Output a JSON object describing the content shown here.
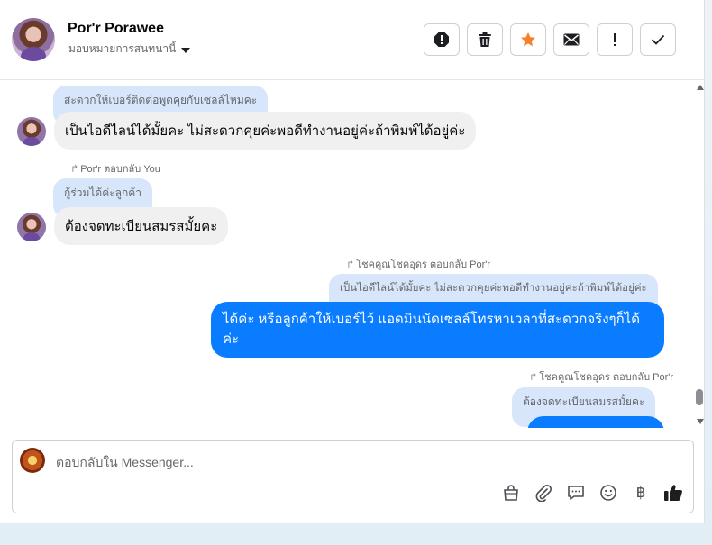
{
  "header": {
    "contact_name": "Por'r Porawee",
    "assign_label": "มอบหมายการสนทนานี้",
    "toolbar_buttons": [
      {
        "icon": "alert-circle-icon"
      },
      {
        "icon": "trash-icon"
      },
      {
        "icon": "star-icon",
        "color": "#f5822a"
      },
      {
        "icon": "envelope-icon"
      },
      {
        "icon": "exclamation-icon"
      },
      {
        "icon": "check-icon"
      }
    ]
  },
  "messages": {
    "m1": {
      "quote": "สะดวกให้เบอร์ติดต่อพูดคุยกับเซลล์ไหมคะ",
      "text": "เป็นไอดีไลน์ได้มั้ยคะ ไม่สะดวกคุยค่ะพอดีทำงานอยู่ค่ะถ้าพิมพ์ได้อยู่ค่ะ"
    },
    "m2": {
      "reply_meta": "Por'r ตอบกลับ You",
      "quote": "กู้ร่วมได้ค่ะลูกค้า",
      "text": "ต้องจดทะเบียนสมรสมั้ยคะ"
    },
    "m3": {
      "reply_meta": "โชคคูณโชคอุดร ตอบกลับ Por'r",
      "quote": "เป็นไอดีไลน์ได้มั้ยคะ ไม่สะดวกคุยค่ะพอดีทำงานอยู่ค่ะถ้าพิมพ์ได้อยู่ค่ะ",
      "text_line1": "ได้ค่ะ หรือลูกค้าให้เบอร์ไว้ แอดมินนัดเซลล์โทรหาเวลาที่สะดวกจริงๆก็ได้",
      "text_line2": "ค่ะ"
    },
    "m4": {
      "reply_meta": "โชคคูณโชคอุดร ตอบกลับ Por'r",
      "quote": "ต้องจดทะเบียนสมรสมั้ยคะ"
    }
  },
  "composer": {
    "placeholder": "ตอบกลับใน Messenger...",
    "icons": [
      "shopping-bag-icon",
      "paperclip-icon",
      "quick-reply-icon",
      "emoji-icon",
      "baht-icon",
      "thumbs-up-icon"
    ],
    "baht_symbol": "฿"
  },
  "colors": {
    "outgoing_bubble": "#0a7cff",
    "incoming_bubble": "#f0f0f0",
    "quote_bubble": "#d8e6fb",
    "star": "#f5822a"
  }
}
